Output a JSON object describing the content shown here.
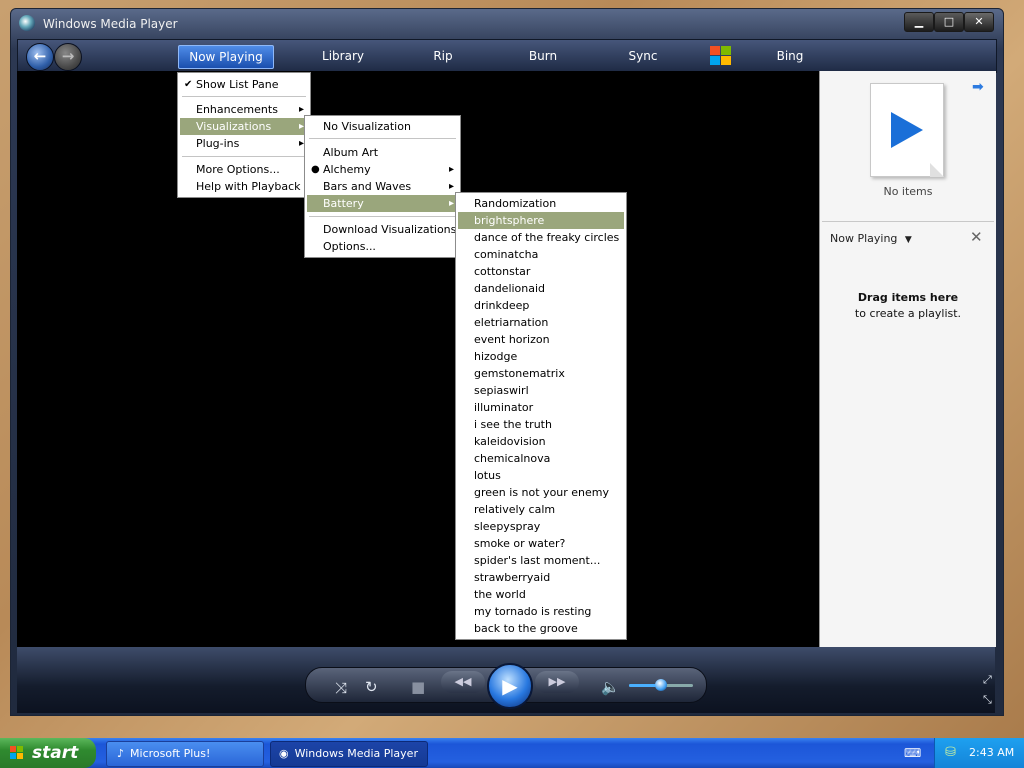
{
  "window": {
    "title": "Windows Media Player",
    "minimize": "▁",
    "maximize": "□",
    "close": "✕"
  },
  "nav": {
    "tabs": [
      {
        "label": "Now Playing"
      },
      {
        "label": "Library"
      },
      {
        "label": "Rip"
      },
      {
        "label": "Burn"
      },
      {
        "label": "Sync"
      },
      {
        "label": "Bing"
      }
    ]
  },
  "menu_now_playing": {
    "items": [
      {
        "label": "Show List Pane",
        "checked": true
      },
      {
        "label": "Enhancements",
        "submenu": true
      },
      {
        "label": "Visualizations",
        "submenu": true,
        "highlighted": true
      },
      {
        "label": "Plug-ins",
        "submenu": true
      },
      {
        "label": "More Options..."
      },
      {
        "label": "Help with Playback"
      }
    ]
  },
  "menu_visualizations": {
    "items": [
      {
        "label": "No Visualization"
      },
      {
        "label": "Album Art"
      },
      {
        "label": "Alchemy",
        "submenu": true,
        "selected": true
      },
      {
        "label": "Bars and Waves",
        "submenu": true
      },
      {
        "label": "Battery",
        "submenu": true,
        "highlighted": true
      },
      {
        "label": "Download Visualizations"
      },
      {
        "label": "Options..."
      }
    ]
  },
  "menu_battery": {
    "items": [
      "Randomization",
      "brightsphere",
      "dance of the freaky circles",
      "cominatcha",
      "cottonstar",
      "dandelionaid",
      "drinkdeep",
      "eletriarnation",
      "event horizon",
      "hizodge",
      "gemstonematrix",
      "sepiaswirl",
      "illuminator",
      "i see the truth",
      "kaleidovision",
      "chemicalnova",
      "lotus",
      "green is not your enemy",
      "relatively calm",
      "sleepyspray",
      "smoke or water?",
      "spider's last moment...",
      "strawberryaid",
      "the world",
      "my tornado is resting",
      "back to the groove"
    ],
    "highlighted_index": 1
  },
  "list_pane": {
    "no_items": "No items",
    "dropdown": "Now Playing",
    "drag_title": "Drag items here",
    "drag_subtitle": "to create a playlist."
  },
  "taskbar": {
    "start": "start",
    "tasks": [
      "Microsoft Plus!",
      "Windows Media Player"
    ],
    "clock": "2:43 AM"
  },
  "colors": {
    "menu_highlight": "#9aa67c",
    "accent": "#1a6fd8"
  }
}
